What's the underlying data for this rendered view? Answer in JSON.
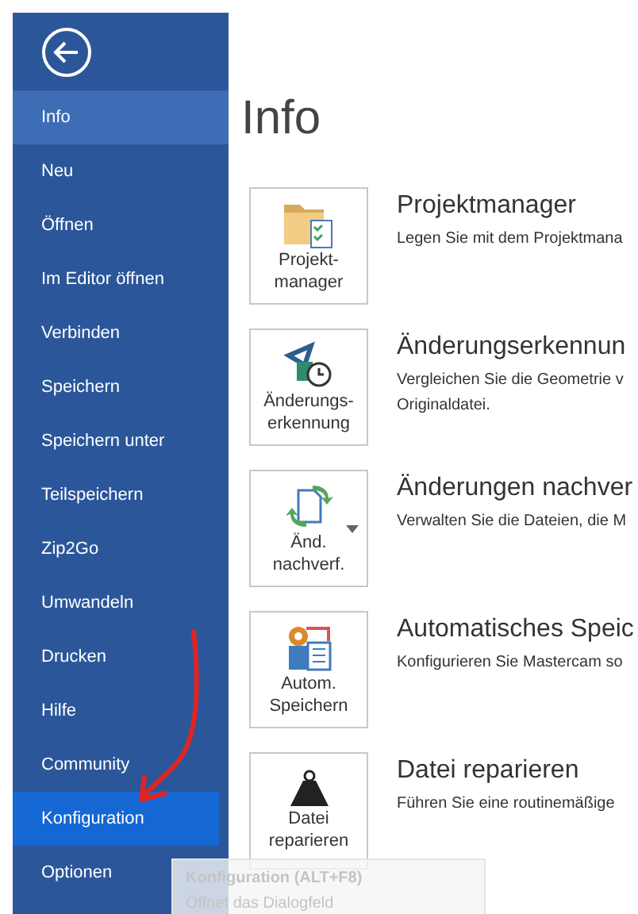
{
  "sidebar": {
    "items": [
      {
        "label": "Info",
        "selected": true
      },
      {
        "label": "Neu",
        "selected": false
      },
      {
        "label": "Öffnen",
        "selected": false
      },
      {
        "label": "Im Editor öffnen",
        "selected": false
      },
      {
        "label": "Verbinden",
        "selected": false
      },
      {
        "label": "Speichern",
        "selected": false
      },
      {
        "label": "Speichern unter",
        "selected": false
      },
      {
        "label": "Teilspeichern",
        "selected": false
      },
      {
        "label": "Zip2Go",
        "selected": false
      },
      {
        "label": "Umwandeln",
        "selected": false
      },
      {
        "label": "Drucken",
        "selected": false
      },
      {
        "label": "Hilfe",
        "selected": false
      },
      {
        "label": "Community",
        "selected": false
      },
      {
        "label": "Konfiguration",
        "selected": false,
        "hovered": true
      },
      {
        "label": "Optionen",
        "selected": false
      }
    ]
  },
  "heading": "Info",
  "sections": [
    {
      "kind": "folder",
      "button_lines": [
        "Projekt-",
        "manager"
      ],
      "dropdown": false,
      "title": "Projektmanager",
      "description": [
        "Legen Sie mit dem Projektmana"
      ]
    },
    {
      "kind": "compare",
      "button_lines": [
        "Änderungs-",
        "erkennung"
      ],
      "dropdown": false,
      "title": "Änderungserkennun",
      "description": [
        "Vergleichen Sie die Geometrie v",
        "Originaldatei."
      ]
    },
    {
      "kind": "sync",
      "button_lines": [
        "Änd.",
        "nachverf."
      ],
      "dropdown": true,
      "title": "Änderungen nachver",
      "description": [
        "Verwalten Sie die Dateien, die M"
      ]
    },
    {
      "kind": "autosave",
      "button_lines": [
        "Autom.",
        "Speichern"
      ],
      "dropdown": false,
      "title": "Automatisches Speic",
      "description": [
        "Konfigurieren Sie Mastercam so"
      ]
    },
    {
      "kind": "repair",
      "button_lines": [
        "Datei",
        "reparieren"
      ],
      "dropdown": false,
      "title": "Datei reparieren",
      "description": [
        "Führen Sie eine routinemäßige"
      ]
    }
  ],
  "tooltip": {
    "title": "Konfiguration (ALT+F8)",
    "text": "Öffnet das Dialogfeld"
  }
}
